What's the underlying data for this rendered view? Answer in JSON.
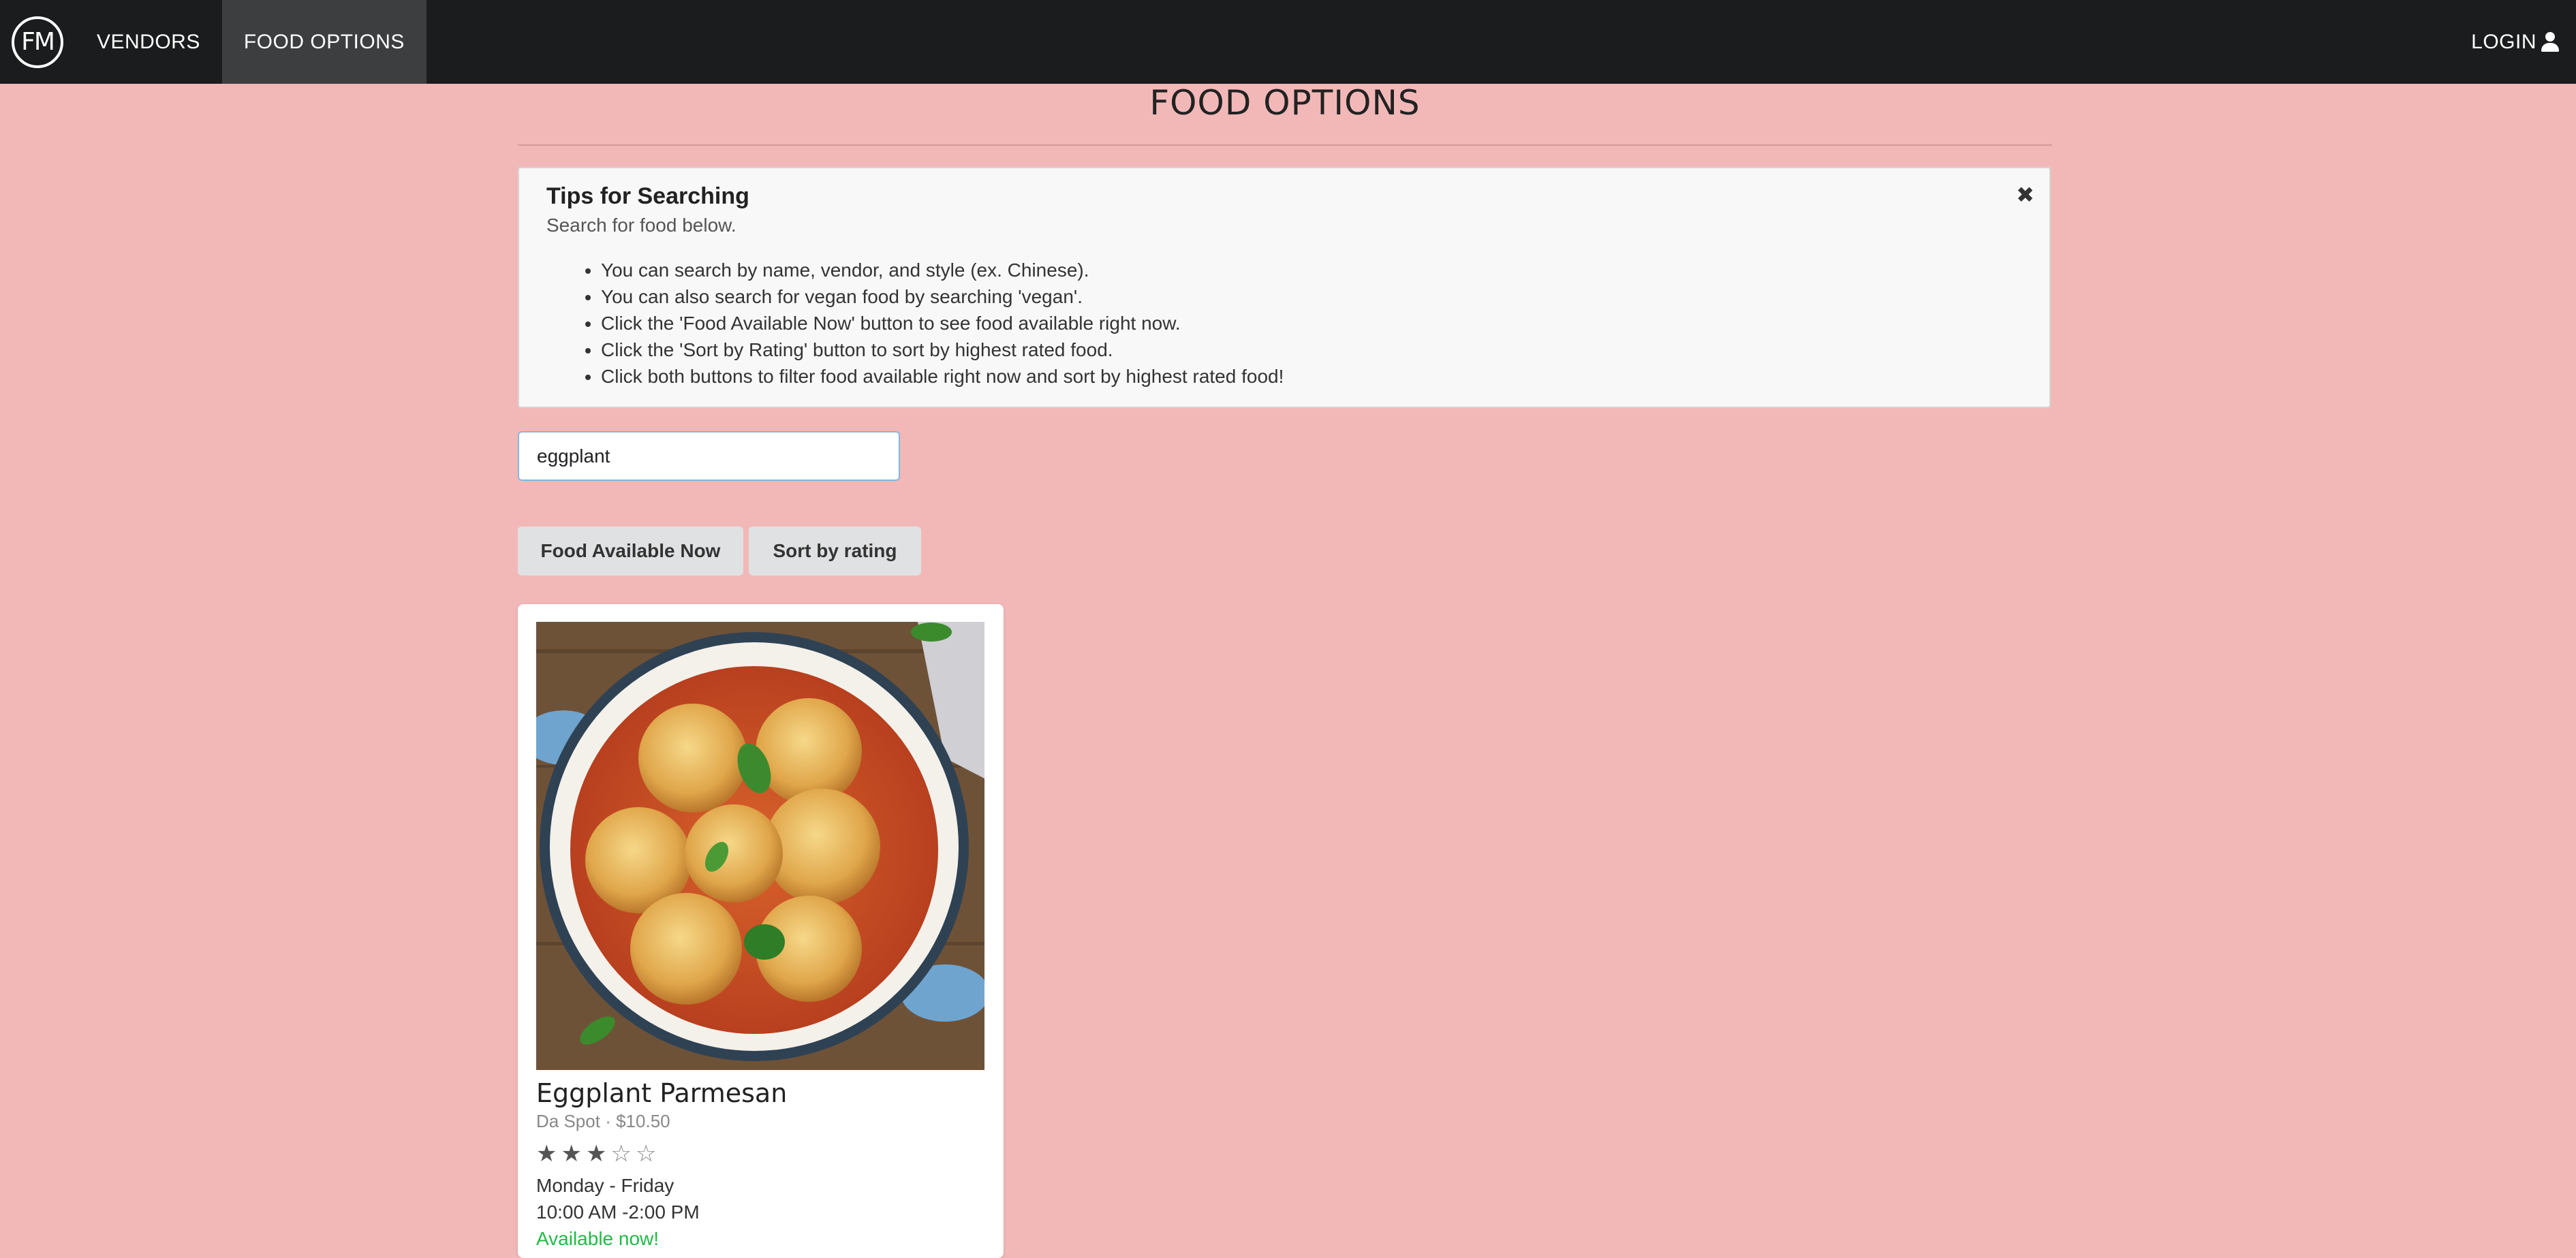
{
  "nav": {
    "logo_text": "FM",
    "items": [
      {
        "label": "VENDORS"
      },
      {
        "label": "FOOD OPTIONS"
      }
    ],
    "login": "LOGIN"
  },
  "page": {
    "title": "FOOD OPTIONS"
  },
  "tips": {
    "title": "Tips for Searching",
    "subtitle": "Search for food below.",
    "items": [
      "You can search by name, vendor, and style (ex. Chinese).",
      "You can also search for vegan food by searching 'vegan'.",
      "Click the 'Food Available Now' button to see food available right now.",
      "Click the 'Sort by Rating' button to sort by highest rated food.",
      "Click both buttons to filter food available right now and sort by highest rated food!"
    ]
  },
  "search": {
    "value": "eggplant"
  },
  "buttons": {
    "available_now": "Food Available Now",
    "sort_rating": "Sort by rating"
  },
  "card": {
    "name": "Eggplant Parmesan",
    "vendor": "Da Spot",
    "separator": "·",
    "price": "$10.50",
    "rating": 3,
    "rating_max": 5,
    "days": "Monday - Friday",
    "hours": "10:00 AM -2:00 PM",
    "availability": "Available now!"
  },
  "colors": {
    "background": "#f2b8b8",
    "navbar": "#1b1c1d",
    "available": "#21ba45"
  }
}
